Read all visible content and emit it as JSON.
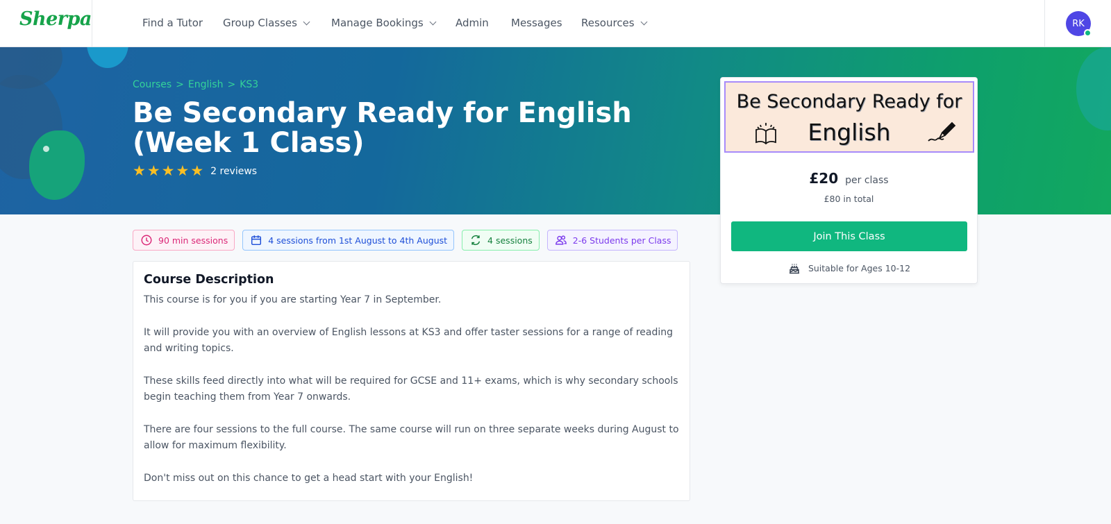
{
  "nav": {
    "logo": "Sherpa",
    "items": [
      {
        "label": "Find a Tutor",
        "dropdown": false
      },
      {
        "label": "Group Classes",
        "dropdown": true
      },
      {
        "label": "Manage Bookings",
        "dropdown": true
      },
      {
        "label": "Admin",
        "dropdown": false
      },
      {
        "label": "Messages",
        "dropdown": false
      },
      {
        "label": "Resources",
        "dropdown": true
      }
    ],
    "user_initials": "RK"
  },
  "hero": {
    "breadcrumb": [
      "Courses",
      ">",
      "English",
      ">",
      "KS3"
    ],
    "title": "Be Secondary Ready for English (Week 1 Class)",
    "rating": 5,
    "reviews": "2 reviews"
  },
  "tags": [
    {
      "icon": "clock-icon",
      "label": "90 min sessions",
      "color": "#db2777"
    },
    {
      "icon": "calendar-icon",
      "label": "4 sessions from 1st August to 4th August",
      "color": "#1d4ed8"
    },
    {
      "icon": "refresh-icon",
      "label": "4 sessions",
      "color": "#15803d"
    },
    {
      "icon": "users-icon",
      "label": "2-6 Students per Class",
      "color": "#7c3aed"
    }
  ],
  "description": {
    "heading": "Course Description",
    "paragraphs": [
      "This course is for you if you are starting Year 7 in September.",
      "It will provide you with an overview of English lessons at KS3 and offer taster sessions for a range of reading and writing topics.",
      "These skills feed directly into what will be required for GCSE and 11+ exams, which is why secondary schools begin teaching them from Year 7 onwards.",
      "There are four sessions to the full course. The same course will run on three separate weeks during August to allow for maximum flexibility.",
      "Don't miss out on this chance to get a head start with your English!"
    ]
  },
  "pricing": {
    "banner_line1": "Be Secondary Ready for",
    "banner_line2": "English",
    "price": "£20",
    "per": "per class",
    "total": "£80 in total",
    "join_label": "Join This Class",
    "ages": "Suitable for Ages 10-12"
  },
  "colors": {
    "brand": "#16a34a",
    "accent_button": "#10b77f",
    "avatar": "#4f46e5",
    "star": "#fbbf24"
  }
}
